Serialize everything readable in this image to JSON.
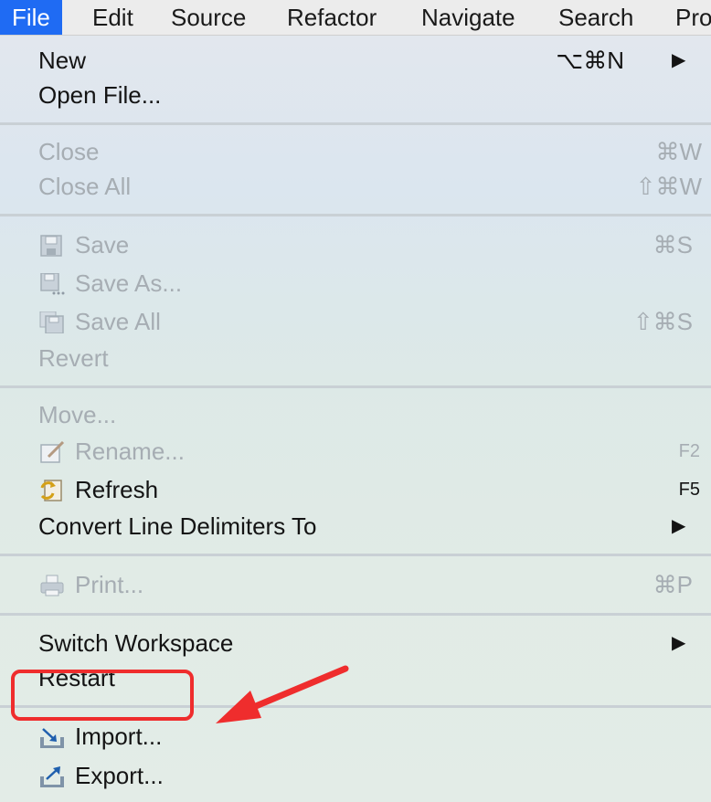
{
  "menubar": {
    "items": [
      "File",
      "Edit",
      "Source",
      "Refactor",
      "Navigate",
      "Search",
      "Pro"
    ]
  },
  "menu": {
    "new": {
      "label": "New",
      "shortcut": "⌥⌘N"
    },
    "open_file": {
      "label": "Open File..."
    },
    "close": {
      "label": "Close",
      "shortcut": "⌘W"
    },
    "close_all": {
      "label": "Close All",
      "shortcut": "⇧⌘W"
    },
    "save": {
      "label": "Save",
      "shortcut": "⌘S"
    },
    "save_as": {
      "label": "Save As..."
    },
    "save_all": {
      "label": "Save All",
      "shortcut": "⇧⌘S"
    },
    "revert": {
      "label": "Revert"
    },
    "move": {
      "label": "Move..."
    },
    "rename": {
      "label": "Rename...",
      "shortcut": "F2"
    },
    "refresh": {
      "label": "Refresh",
      "shortcut": "F5"
    },
    "convert": {
      "label": "Convert Line Delimiters To"
    },
    "print": {
      "label": "Print...",
      "shortcut": "⌘P"
    },
    "switch_workspace": {
      "label": "Switch Workspace"
    },
    "restart": {
      "label": "Restart"
    },
    "import": {
      "label": "Import..."
    },
    "export": {
      "label": "Export..."
    }
  },
  "colors": {
    "active_menu": "#1f6bf3",
    "annotation": "#ef2d2d",
    "disabled_text": "#a6adb3"
  }
}
